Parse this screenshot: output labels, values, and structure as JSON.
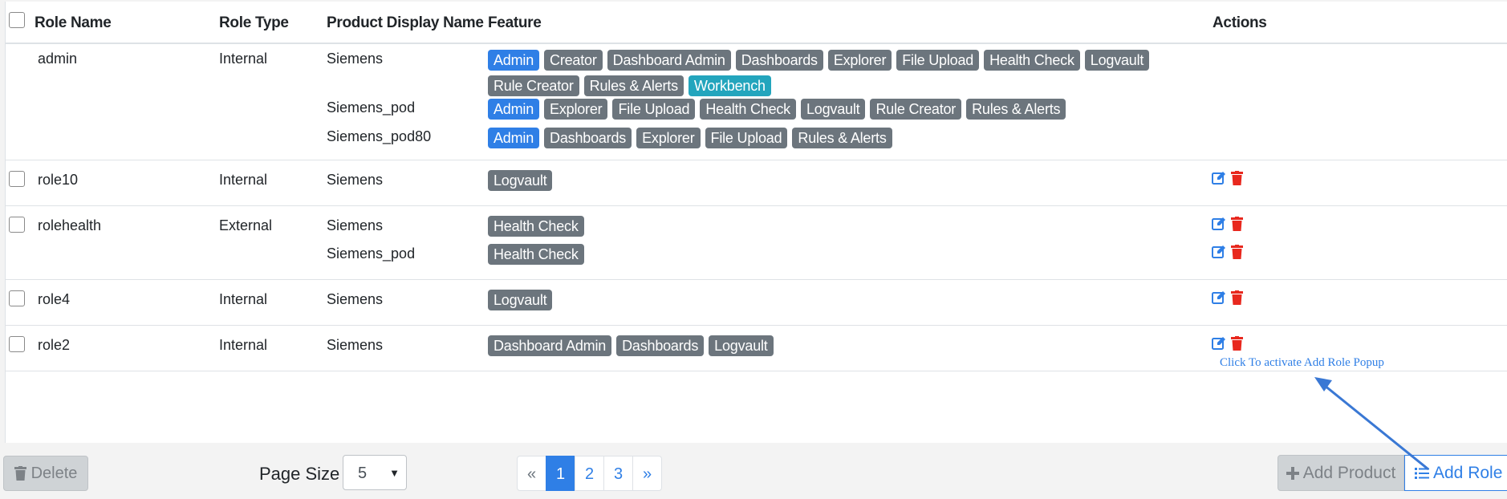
{
  "table": {
    "headers": {
      "role_name": "Role Name",
      "role_type": "Role Type",
      "product_display_name": "Product Display Name",
      "feature": "Feature",
      "actions": "Actions"
    },
    "rows": [
      {
        "role_name": "admin",
        "role_type": "Internal",
        "products": [
          {
            "name": "Siemens",
            "features": [
              "Admin",
              "Creator",
              "Dashboard Admin",
              "Dashboards",
              "Explorer",
              "File Upload",
              "Health Check",
              "Logvault",
              "Rule Creator",
              "Rules & Alerts",
              "Workbench"
            ]
          },
          {
            "name": "Siemens_pod",
            "features": [
              "Admin",
              "Explorer",
              "File Upload",
              "Health Check",
              "Logvault",
              "Rule Creator",
              "Rules & Alerts"
            ]
          },
          {
            "name": "Siemens_pod80",
            "features": [
              "Admin",
              "Dashboards",
              "Explorer",
              "File Upload",
              "Rules & Alerts"
            ]
          }
        ]
      },
      {
        "role_name": "role10",
        "role_type": "Internal",
        "products": [
          {
            "name": "Siemens",
            "features": [
              "Logvault"
            ]
          }
        ]
      },
      {
        "role_name": "rolehealth",
        "role_type": "External",
        "products": [
          {
            "name": "Siemens",
            "features": [
              "Health Check"
            ]
          },
          {
            "name": "Siemens_pod",
            "features": [
              "Health Check"
            ]
          }
        ]
      },
      {
        "role_name": "role4",
        "role_type": "Internal",
        "products": [
          {
            "name": "Siemens",
            "features": [
              "Logvault"
            ]
          }
        ]
      },
      {
        "role_name": "role2",
        "role_type": "Internal",
        "products": [
          {
            "name": "Siemens",
            "features": [
              "Dashboard Admin",
              "Dashboards",
              "Logvault"
            ]
          }
        ]
      }
    ]
  },
  "footer": {
    "delete_label": "Delete",
    "page_size_label": "Page Size",
    "page_size_value": "5",
    "pagination": {
      "prev": "«",
      "pages": [
        "1",
        "2",
        "3"
      ],
      "next": "»",
      "current": "1"
    },
    "add_product_label": "Add Product",
    "add_role_label": "Add Role"
  },
  "annotation": {
    "text": "Click To activate Add Role Popup"
  },
  "colors": {
    "badge_primary": "#2f7fe6",
    "badge_secondary": "#6c757d",
    "badge_info": "#23a5bd",
    "edit_icon": "#2f7fe6",
    "delete_icon": "#e8281e"
  }
}
